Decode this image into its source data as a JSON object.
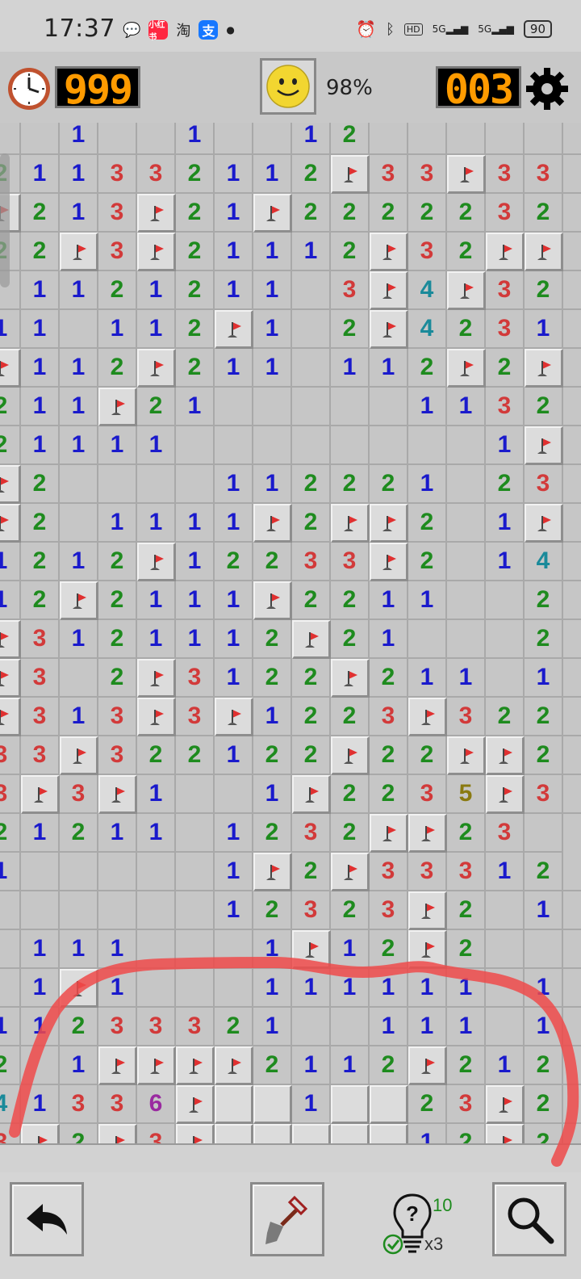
{
  "status_bar": {
    "time": "17:37",
    "app_chips": [
      "小红书",
      "淘",
      "支"
    ],
    "network_badges": [
      "HD",
      "5G",
      "5G"
    ],
    "battery": "90"
  },
  "header": {
    "timer": "999",
    "progress_percent": "98%",
    "mine_counter": "003"
  },
  "colors": {
    "1": "#1a1acc",
    "2": "#1e8b1e",
    "3": "#d23a3a",
    "4": "#1a8a9a",
    "5": "#8a7a10",
    "6": "#9a2aa0",
    "flag": "#e03030",
    "stroke": "#ef4a4a"
  },
  "board": {
    "rows": [
      ". . 1 . . 1 . . 1 2 . . . . . .",
      "2 1 1 3 3 2 1 1 2 F 3 3 F 3 3 .",
      "F 2 1 3 F 2 1 F 2 2 2 2 2 3 2 .",
      "2 2 F 3 F 2 1 1 1 2 F 3 2 F F .",
      ". 1 1 2 1 2 1 1 . 3 F 4 F 3 2 .",
      "1 1 . 1 1 2 F 1 . 2 F 4 2 3 1 .",
      "F 1 1 2 F 2 1 1 . 1 1 2 F 2 F .",
      "2 1 1 F 2 1 . . . . . 1 1 3 2 .",
      "2 1 1 1 1 . . . . . . . . 1 F .",
      "F 2 . . . . 1 1 2 2 2 1 . 2 3 .",
      "F 2 . 1 1 1 1 F 2 F F 2 . 1 F .",
      "1 2 1 2 F 1 2 2 3 3 F 2 . 1 4 .",
      "1 2 F 2 1 1 1 F 2 2 1 1 . . 2 .",
      "F 3 1 2 1 1 1 2 F 2 1 . . . 2 .",
      "F 3 . 2 F 3 1 2 2 F 2 1 1 . 1 .",
      "F 3 1 3 F 3 F 1 2 2 3 F 3 2 2 .",
      "3 3 F 3 2 2 1 2 2 F 2 2 F F 2 .",
      "3 F 3 F 1 . . 1 F 2 2 3 5 F 3 .",
      "2 1 2 1 1 . 1 2 3 2 F F 2 3 .",
      "1 . . . . . 1 F 2 F 3 3 3 1 2 .",
      ". . . . . . 1 2 3 2 3 F 2 . 1 .",
      ". 1 1 1 . . . 1 F 1 2 F 2 . . .",
      ". 1 F 1 . . . 1 1 1 1 1 1 . 1 .",
      "1 1 2 3 3 3 2 1 . . 1 1 1 . 1 .",
      "2 . 1 F F F F 2 1 1 2 F 2 1 2 .",
      "4 1 3 3 6 F C C 1 C C 2 3 F 2 .",
      "3 F 2 F 3 F C C C C C 1 2 F 2 ."
    ]
  },
  "toolbar": {
    "undo_label": "undo",
    "dig_label": "dig",
    "hint_count": "10",
    "hint_multiplier": "x3",
    "inspect_label": "inspect"
  }
}
